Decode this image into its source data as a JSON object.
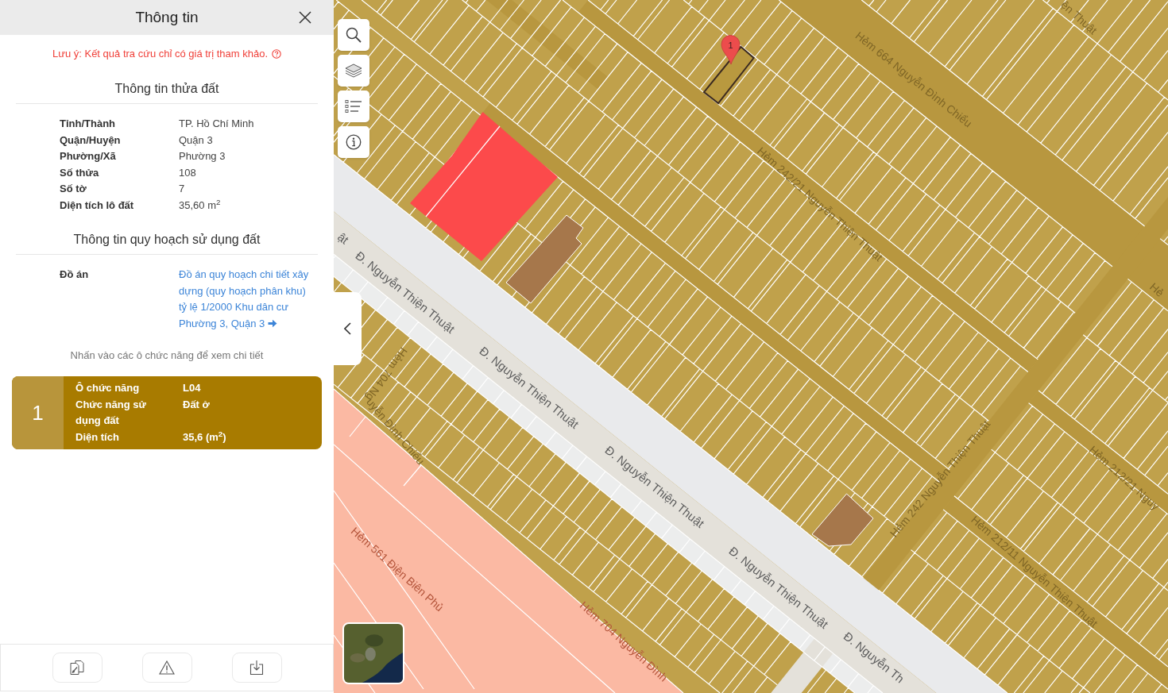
{
  "panel": {
    "title": "Thông tin",
    "notice": "Lưu ý: Kết quả tra cứu chỉ có giá trị tham khảo.",
    "sections": [
      {
        "heading": "Thông tin thửa đất",
        "rows": [
          {
            "kind": "text",
            "label": "Tỉnh/Thành",
            "value": "TP. Hồ Chí Minh"
          },
          {
            "kind": "text",
            "label": "Quận/Huyện",
            "value": "Quận 3"
          },
          {
            "kind": "text",
            "label": "Phường/Xã",
            "value": "Phường 3"
          },
          {
            "kind": "text",
            "label": "Số thửa",
            "value": "108"
          },
          {
            "kind": "text",
            "label": "Số tờ",
            "value": "7"
          },
          {
            "kind": "text",
            "label": "Diện tích lô đất",
            "value": "35,60 m$^{2}$"
          }
        ]
      },
      {
        "heading": "Thông tin quy hoạch sử dụng đất",
        "rows": [
          {
            "kind": "link",
            "label": "Đồ án",
            "value": "Đồ án quy hoạch chi tiết xây dựng (quy hoạch phân khu) tỷ lệ 1/2000 Khu dân cư Phường 3, Quận 3"
          }
        ]
      }
    ],
    "hint": "Nhấn vào các ô chức năng để xem chi tiết",
    "zones": [
      {
        "number": "1",
        "rows": [
          {
            "label": "Ô chức năng",
            "value": "L04"
          },
          {
            "label": "Chức năng sử dụng đất",
            "value": "Đất ở"
          },
          {
            "label": "Diện tích",
            "value": "35,6 (m$^{2}$)"
          }
        ]
      }
    ]
  },
  "map": {
    "marker": {
      "number": "1"
    },
    "labels": [
      {
        "kind": "road",
        "text": "ật"
      },
      {
        "kind": "road",
        "text": "Đ. Nguyễn Thiện Thuật"
      },
      {
        "kind": "road",
        "text": "Đ. Nguyễn Thiện Thuật"
      },
      {
        "kind": "road",
        "text": "Đ. Nguyễn Thiện Thuật"
      },
      {
        "kind": "road",
        "text": "Đ. Nguyễn Thiện Thuật"
      },
      {
        "kind": "road",
        "text": "Đ. Nguyễn Th"
      },
      {
        "kind": "alley",
        "text": "Hẻm 664 Nguyễn Đình Chiểu"
      },
      {
        "kind": "alley",
        "text": "Hẻm 242/21 Nguyễn Thiện Thuật"
      },
      {
        "kind": "alley",
        "text": "ện Thuật"
      },
      {
        "kind": "alley",
        "text": "Hẻ"
      },
      {
        "kind": "alley",
        "text": "Hẻm 242 Nguyễn Thiện Thuật"
      },
      {
        "kind": "alley",
        "text": "Hẻm 212/21 Nguy"
      },
      {
        "kind": "alley",
        "text": "Hẻm 212/11 Nguyễn Thiện Thuật"
      },
      {
        "kind": "alley",
        "text": "Hẻm 704 Nguyễn Đình Chiểu"
      },
      {
        "kind": "zone",
        "text": "Hẻm 561 Điện Biên Phủ"
      },
      {
        "kind": "zone",
        "text": "Hẻm 704 Nguyễn Đình"
      }
    ]
  }
}
